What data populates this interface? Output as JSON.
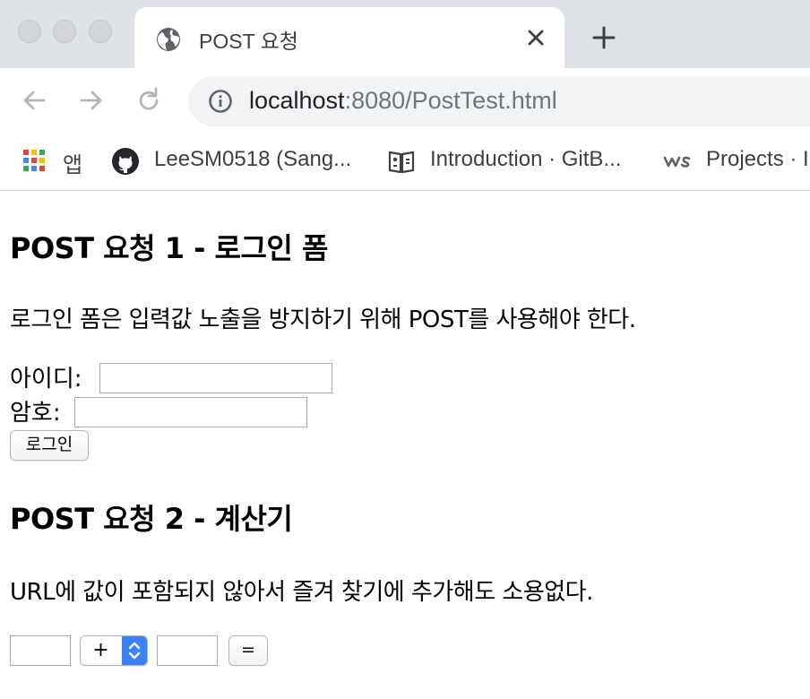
{
  "browser": {
    "tab": {
      "title": "POST 요청"
    },
    "address_bar": {
      "host": "localhost",
      "rest": ":8080/PostTest.html"
    },
    "bookmarks": [
      {
        "label": "앱",
        "icon": "apps-grid-icon"
      },
      {
        "label": "LeeSM0518 (Sang...",
        "icon": "github-icon"
      },
      {
        "label": "Introduction · GitB...",
        "icon": "book-icon"
      },
      {
        "label": "Projects · I",
        "icon": "ws-logo-icon"
      }
    ]
  },
  "page": {
    "section1": {
      "heading": "POST 요청 1 - 로그인 폼",
      "description": "로그인 폼은 입력값 노출을 방지하기 위해 POST를 사용해야 한다.",
      "id_label": "아이디:",
      "id_value": "",
      "pw_label": "암호:",
      "pw_value": "",
      "submit_label": "로그인"
    },
    "section2": {
      "heading": "POST 요청 2 - 계산기",
      "description": "URL에 값이 포함되지 않아서 즐겨 찾기에 추가해도 소용없다.",
      "operand1_value": "",
      "operator_selected": "+",
      "operand2_value": "",
      "equals_label": "="
    }
  },
  "colors": {
    "tabstrip_bg": "#dee1e6",
    "omnibox_bg": "#f1f3f4",
    "select_accent": "#3b82f6"
  }
}
